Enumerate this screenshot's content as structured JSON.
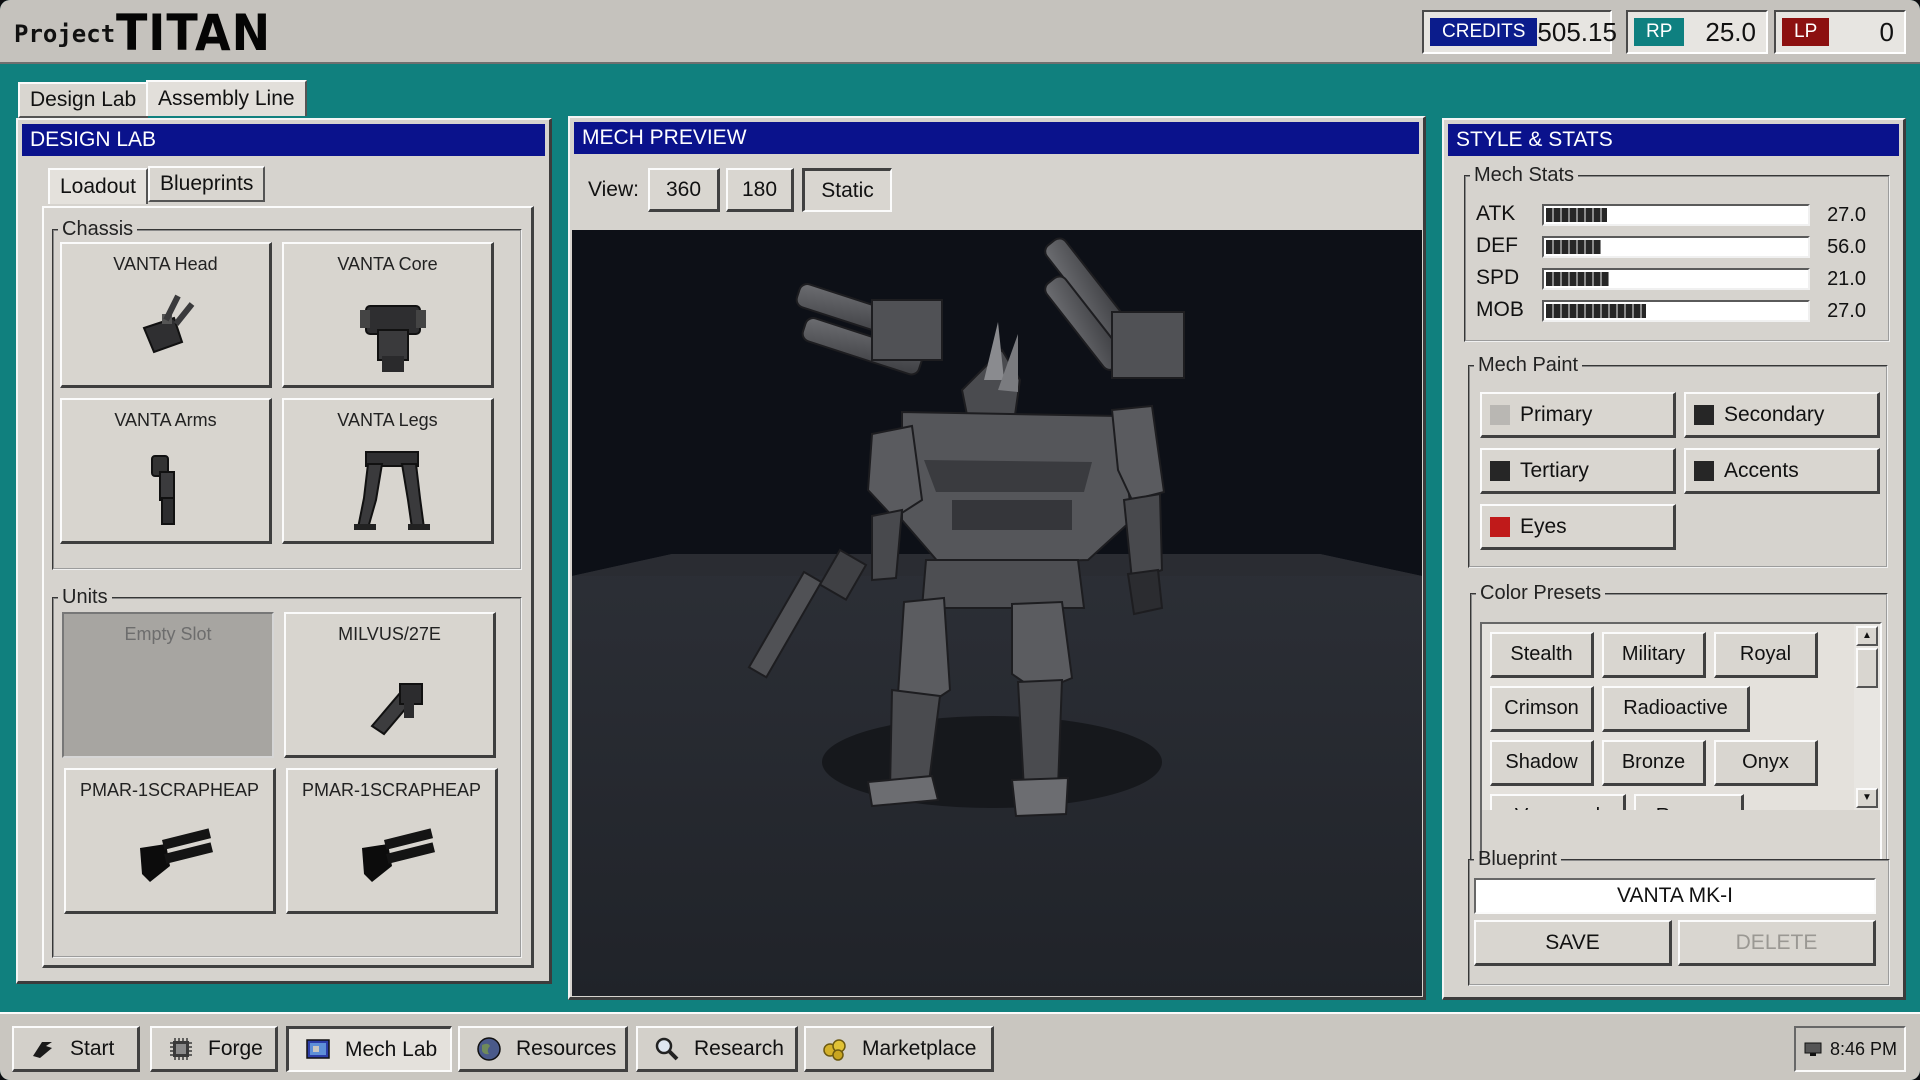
{
  "app": {
    "title_small": "Project",
    "title_big": "TITAN"
  },
  "currencies": [
    {
      "label": "CREDITS",
      "value": "505.15",
      "color": "#0b1c8c"
    },
    {
      "label": "RP",
      "value": "25.0",
      "color": "#0e8080"
    },
    {
      "label": "LP",
      "value": "0",
      "color": "#8c1010"
    }
  ],
  "top_tabs": [
    "Design Lab",
    "Assembly Line"
  ],
  "design_lab": {
    "title": "DESIGN LAB",
    "tabs": [
      "Loadout",
      "Blueprints"
    ],
    "chassis_legend": "Chassis",
    "chassis": [
      "VANTA Head",
      "VANTA Core",
      "VANTA Arms",
      "VANTA Legs"
    ],
    "units_legend": "Units",
    "units": [
      "Empty Slot",
      "MILVUS/27E",
      "PMAR-1SCRAPHEAP",
      "PMAR-1SCRAPHEAP"
    ]
  },
  "preview": {
    "title": "MECH PREVIEW",
    "view_label": "View:",
    "view_buttons": [
      "360",
      "180",
      "Static"
    ],
    "selected_view": "Static"
  },
  "style_stats": {
    "title": "STYLE & STATS",
    "stats_legend": "Mech Stats",
    "stats": [
      {
        "name": "ATK",
        "value": "27.0",
        "fraction": 0.23
      },
      {
        "name": "DEF",
        "value": "56.0",
        "fraction": 0.21
      },
      {
        "name": "SPD",
        "value": "21.0",
        "fraction": 0.24
      },
      {
        "name": "MOB",
        "value": "27.0",
        "fraction": 0.38
      }
    ],
    "paint_legend": "Mech Paint",
    "paint": [
      {
        "label": "Primary",
        "color": "#b9b7b3"
      },
      {
        "label": "Secondary",
        "color": "#262626"
      },
      {
        "label": "Tertiary",
        "color": "#262626"
      },
      {
        "label": "Accents",
        "color": "#262626"
      },
      {
        "label": "Eyes",
        "color": "#c01a1a"
      }
    ],
    "presets_legend": "Color Presets",
    "presets": [
      "Stealth",
      "Military",
      "Royal",
      "Crimson",
      "Radioactive",
      "Shadow",
      "Bronze",
      "Onyx",
      "Vanguard",
      "Reaper"
    ],
    "blueprint_legend": "Blueprint",
    "blueprint_name": "VANTA MK-I",
    "save_label": "SAVE",
    "delete_label": "DELETE"
  },
  "taskbar": {
    "start": "Start",
    "items": [
      "Forge",
      "Mech Lab",
      "Resources",
      "Research",
      "Marketplace"
    ],
    "active": "Mech Lab",
    "clock": "8:46 PM"
  }
}
